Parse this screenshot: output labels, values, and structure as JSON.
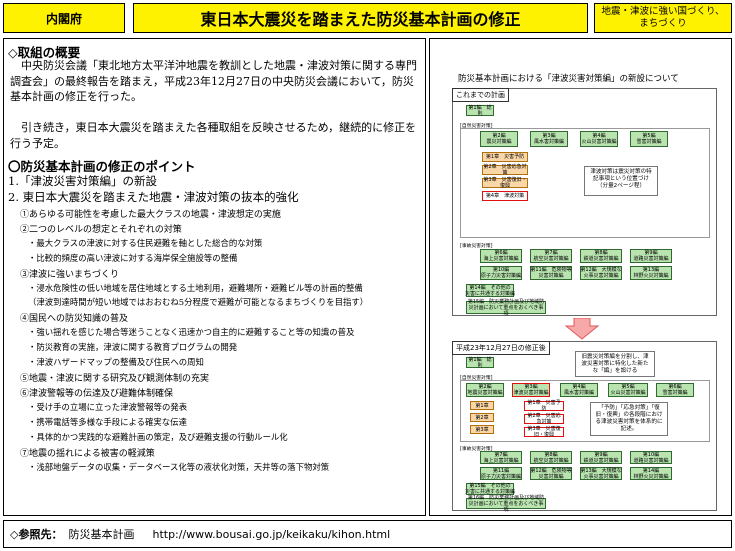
{
  "header": {
    "org": "内閣府",
    "title": "東日本大震災を踏まえた防災基本計画の修正",
    "category": "地震・津波に強い国づくり、まちづくり"
  },
  "summary": {
    "heading": "◇取組の概要",
    "para1": "中央防災会議「東北地方太平洋沖地震を教訓とした地震・津波対策に関する専門調査会」の最終報告を踏まえ，平成23年12月27日の中央防災会議において，防災基本計画の修正を行った。",
    "para2": "引き続き，東日本大震災を踏まえた各種取組を反映させるため，継続的に修正を行う予定。"
  },
  "points": {
    "heading": "〇防災基本計画の修正のポイント",
    "item1": "1.「津波災害対策編」の新設",
    "item2": "2. 東日本大震災を踏まえた地震・津波対策の抜本的強化",
    "sub": [
      "①あらゆる可能性を考慮した最大クラスの地震・津波想定の実施",
      "②二つのレベルの想定とそれぞれの対策",
      "・最大クラスの津波に対する住民避難を軸とした総合的な対策",
      "・比較的頻度の高い津波に対する海岸保全施設等の整備",
      "③津波に強いまちづくり",
      "・浸水危険性の低い地域を居住地域とする土地利用，避難場所・避難ビル等の計画的整備",
      "（津波到達時間が短い地域ではおおむね5分程度で避難が可能となるまちづくりを目指す）",
      "④国民への防災知識の普及",
      "・強い揺れを感じた場合等迷うことなく迅速かつ自主的に避難すること等の知識の普及",
      "・防災教育の実施，津波に関する教育プログラムの開発",
      "・津波ハザードマップの整備及び住民への周知",
      "⑤地震・津波に関する研究及び観測体制の充実",
      "⑥津波警報等の伝達及び避難体制確保",
      "・受け手の立場に立った津波警報等の発表",
      "・携帯電話等多様な手段による確実な伝達",
      "・具体的かつ実践的な避難計画の策定，及び避難支援の行動ルール化",
      "⑦地震の揺れによる被害の軽減策",
      "・浅部地盤データの収集・データベース化等の液状化対策，天井等の落下物対策"
    ]
  },
  "diagram": {
    "title": "防災基本計画における「津波災害対策編」の新設について",
    "before_label": "これまでの計画",
    "after_label": "平成23年12月27日の修正後",
    "before": {
      "hen1": "第1編　総　則",
      "nature_hdr": "[自然災害対策]",
      "row1": [
        "第2編\n震災対策編",
        "第3編\n風水害対策編",
        "第4編\n火山災害対策編",
        "第5編\n雪害対策編"
      ],
      "chapters": [
        "第1章　災害予防",
        "第2章　災害応急対策",
        "第3章　災害復旧・復興",
        "第4章　津波対策"
      ],
      "note": "津波対策は震災対策の特記事項という位置づけ（分量2ページ程）",
      "accident_hdr": "[事故災害対策]",
      "row2": [
        "第6編\n海上災害対策編",
        "第7編\n航空災害対策編",
        "第8編\n鉄道災害対策編",
        "第9編\n道路災害対策編"
      ],
      "row3": [
        "第10編\n原子力災害対策編",
        "第11編　危険物等\n災害対策編",
        "第12編　大規模な\n火事災害対策編",
        "第13編\n林野火災対策編"
      ],
      "hen14": "第14編　その他の\n災害に共通する対策編",
      "hen15": "第15編　防災業務計画及び地域防災計画において重点をおくべき事項"
    },
    "after": {
      "hen1": "第1編　総　則",
      "nature_hdr": "[自然災害対策]",
      "row1": [
        "第2編\n地震災害対策編",
        "第3編\n津波災害対策編",
        "第4編\n風水害対策編",
        "第5編\n火山災害対策編",
        "第6編\n雪害対策編"
      ],
      "chapters_left": [
        "第1章",
        "第2章",
        "第3章"
      ],
      "chapters": [
        "第1章　災害予防",
        "第2章　災害応急対策",
        "第3章　災害復旧・復興"
      ],
      "note1": "旧震災対策編を分割し、津波災害対策に特化した新たな「編」を設ける",
      "note2": "「予防」「応急対策」「復旧・復興」の各段階における津波災害対策を体系的に記述。",
      "accident_hdr": "[事故災害対策]",
      "row2": [
        "第7編\n海上災害対策編",
        "第8編\n航空災害対策編",
        "第9編\n鉄道災害対策編",
        "第10編\n道路災害対策編"
      ],
      "row3": [
        "第11編\n原子力災害対策編",
        "第12編　危険物等\n災害対策編",
        "第13編　大規模な\n火事災害対策編",
        "第14編\n林野火災対策編"
      ],
      "hen15": "第15編　その他の\n災害に共通する対策編",
      "hen16": "第16編　防災業務計画及び地域防災計画において重点をおくべき事項"
    }
  },
  "footer": {
    "label": "◇参照先：",
    "text": "防災基本計画",
    "url": "http://www.bousai.go.jp/keikaku/kihon.html"
  }
}
